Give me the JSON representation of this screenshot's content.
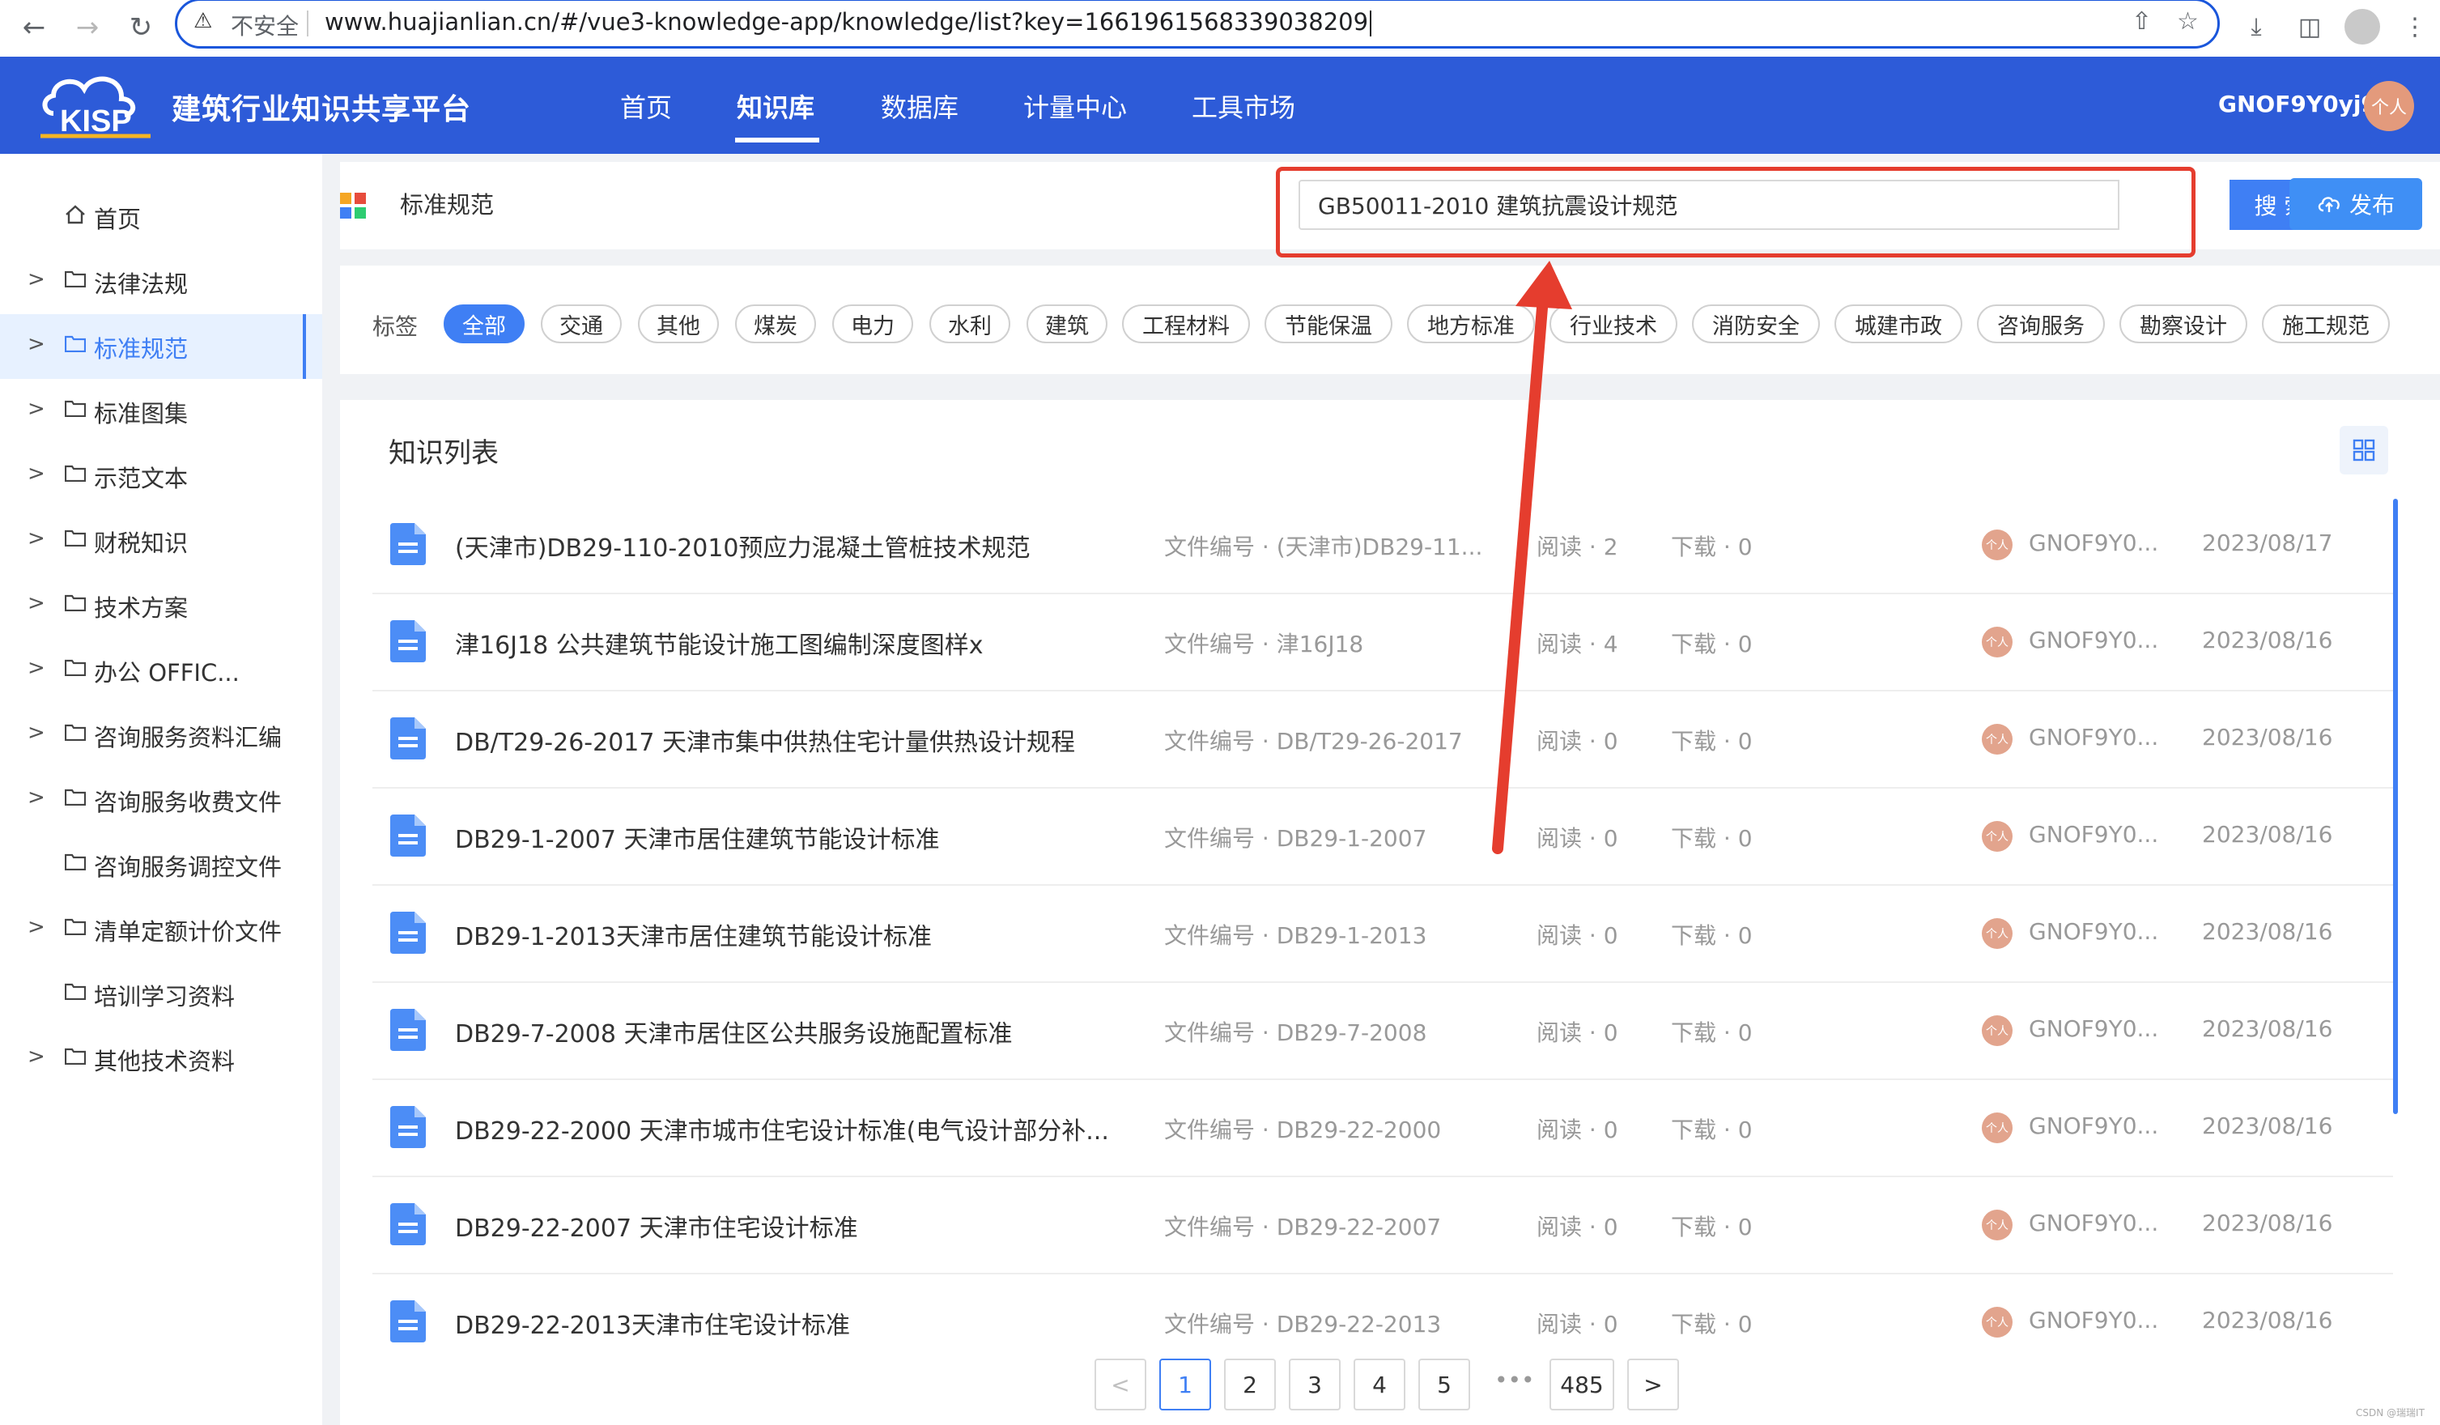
{
  "browser": {
    "security_label": "不安全",
    "url": "www.huajianlian.cn/#/vue3-knowledge-app/knowledge/list?key=1661961568339038209"
  },
  "header": {
    "logo_text": "KISP",
    "platform_title": "建筑行业知识共享平台",
    "nav": [
      "首页",
      "知识库",
      "数据库",
      "计量中心",
      "工具市场"
    ],
    "active_nav": "知识库",
    "username": "GNOF9Y0yj9",
    "avatar_text": "个人"
  },
  "sidebar": {
    "items": [
      {
        "label": "首页",
        "expandable": false
      },
      {
        "label": "法律法规",
        "expandable": true
      },
      {
        "label": "标准规范",
        "expandable": true,
        "active": true
      },
      {
        "label": "标准图集",
        "expandable": true
      },
      {
        "label": "示范文本",
        "expandable": true
      },
      {
        "label": "财税知识",
        "expandable": true
      },
      {
        "label": "技术方案",
        "expandable": true
      },
      {
        "label": "办公 OFFIC...",
        "expandable": true
      },
      {
        "label": "咨询服务资料汇编",
        "expandable": true
      },
      {
        "label": "咨询服务收费文件",
        "expandable": true
      },
      {
        "label": "咨询服务调控文件",
        "expandable": false
      },
      {
        "label": "清单定额计价文件",
        "expandable": true
      },
      {
        "label": "培训学习资料",
        "expandable": false
      },
      {
        "label": "其他技术资料",
        "expandable": true
      }
    ]
  },
  "topbar": {
    "category_title": "标准规范",
    "search_value": "GB50011-2010 建筑抗震设计规范",
    "search_button": "搜 索",
    "publish_button": "发布"
  },
  "tags": {
    "label": "标签",
    "items": [
      "全部",
      "交通",
      "其他",
      "煤炭",
      "电力",
      "水利",
      "建筑",
      "工程材料",
      "节能保温",
      "地方标准",
      "行业技术",
      "消防安全",
      "城建市政",
      "咨询服务",
      "勘察设计",
      "施工规范"
    ],
    "active": "全部"
  },
  "list": {
    "title": "知识列表",
    "rows": [
      {
        "title": "(天津市)DB29-110-2010预应力混凝土管桩技术规范",
        "fileno": "文件编号 · (天津市)DB29-11...",
        "reads": "阅读 · 2",
        "downloads": "下载 · 0",
        "author": "GNOF9Y0...",
        "date": "2023/08/17"
      },
      {
        "title": "津16J18 公共建筑节能设计施工图编制深度图样x",
        "fileno": "文件编号 · 津16J18",
        "reads": "阅读 · 4",
        "downloads": "下载 · 0",
        "author": "GNOF9Y0...",
        "date": "2023/08/16"
      },
      {
        "title": "DB/T29-26-2017 天津市集中供热住宅计量供热设计规程",
        "fileno": "文件编号 · DB/T29-26-2017",
        "reads": "阅读 · 0",
        "downloads": "下载 · 0",
        "author": "GNOF9Y0...",
        "date": "2023/08/16"
      },
      {
        "title": "DB29-1-2007 天津市居住建筑节能设计标准",
        "fileno": "文件编号 · DB29-1-2007",
        "reads": "阅读 · 0",
        "downloads": "下载 · 0",
        "author": "GNOF9Y0...",
        "date": "2023/08/16"
      },
      {
        "title": "DB29-1-2013天津市居住建筑节能设计标准",
        "fileno": "文件编号 · DB29-1-2013",
        "reads": "阅读 · 0",
        "downloads": "下载 · 0",
        "author": "GNOF9Y0...",
        "date": "2023/08/16"
      },
      {
        "title": "DB29-7-2008 天津市居住区公共服务设施配置标准",
        "fileno": "文件编号 · DB29-7-2008",
        "reads": "阅读 · 0",
        "downloads": "下载 · 0",
        "author": "GNOF9Y0...",
        "date": "2023/08/16"
      },
      {
        "title": "DB29-22-2000 天津市城市住宅设计标准(电气设计部分补...",
        "fileno": "文件编号 · DB29-22-2000",
        "reads": "阅读 · 0",
        "downloads": "下载 · 0",
        "author": "GNOF9Y0...",
        "date": "2023/08/16"
      },
      {
        "title": "DB29-22-2007 天津市住宅设计标准",
        "fileno": "文件编号 · DB29-22-2007",
        "reads": "阅读 · 0",
        "downloads": "下载 · 0",
        "author": "GNOF9Y0...",
        "date": "2023/08/16"
      },
      {
        "title": "DB29-22-2013天津市住宅设计标准",
        "fileno": "文件编号 · DB29-22-2013",
        "reads": "阅读 · 0",
        "downloads": "下载 · 0",
        "author": "GNOF9Y0...",
        "date": "2023/08/16"
      }
    ],
    "row_avatar_text": "个人"
  },
  "pagination": {
    "prev": "<",
    "pages": [
      "1",
      "2",
      "3",
      "4",
      "5"
    ],
    "ellipsis": "•••",
    "last": "485",
    "next": ">",
    "current": "1"
  },
  "watermark": "CSDN @瑞瑞IT",
  "colors": {
    "header_bg": "#2d5bd8",
    "accent": "#3f7ff4",
    "highlight_red": "#e53d2e"
  }
}
